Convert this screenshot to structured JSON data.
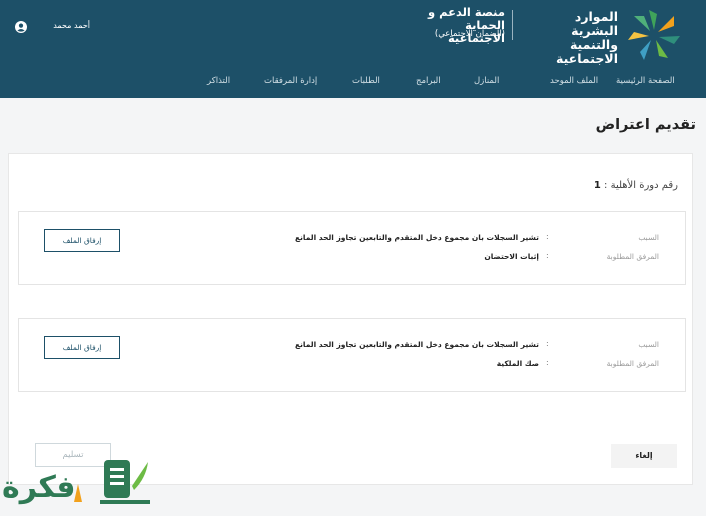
{
  "header": {
    "ministry_name": "الموارد البشرية والتنمية الاجتماعية",
    "platform_name": "منصة الدعم و الحماية الاجتماعية",
    "platform_sub": "(الضمان الاجتماعي)",
    "user_name": "أحمد محمد"
  },
  "nav": {
    "items": [
      "الصفحة الرئيسية",
      "الملف الموحد",
      "المنازل",
      "البرامج",
      "الطلبات",
      "إدارة المرفقات",
      "التذاكر"
    ]
  },
  "page": {
    "title": "تقديم اعتراض",
    "cycle_label": "رقم دورة الأهلية :",
    "cycle_value": "1"
  },
  "requests": [
    {
      "reason_label": "السبب",
      "reason_value": "تشير السجلات بان مجموع دخل المتقدم والتابعين تجاوز الحد المانع",
      "attachment_label": "المرفق المطلوبة",
      "attachment_value": "إثبات الاحتضان",
      "button_label": "إرفاق الملف"
    },
    {
      "reason_label": "السبب",
      "reason_value": "تشير السجلات بان مجموع دخل المتقدم والتابعين تجاوز الحد المانع",
      "attachment_label": "المرفق المطلوبة",
      "attachment_value": "صك الملكية",
      "button_label": "إرفاق الملف"
    }
  ],
  "actions": {
    "submit_label": "تسليم",
    "cancel_label": "إلغاء"
  },
  "watermark": {
    "text": "فكرة"
  },
  "colors": {
    "header_bg": "#1d5068",
    "accent_green": "#2f7a55"
  }
}
